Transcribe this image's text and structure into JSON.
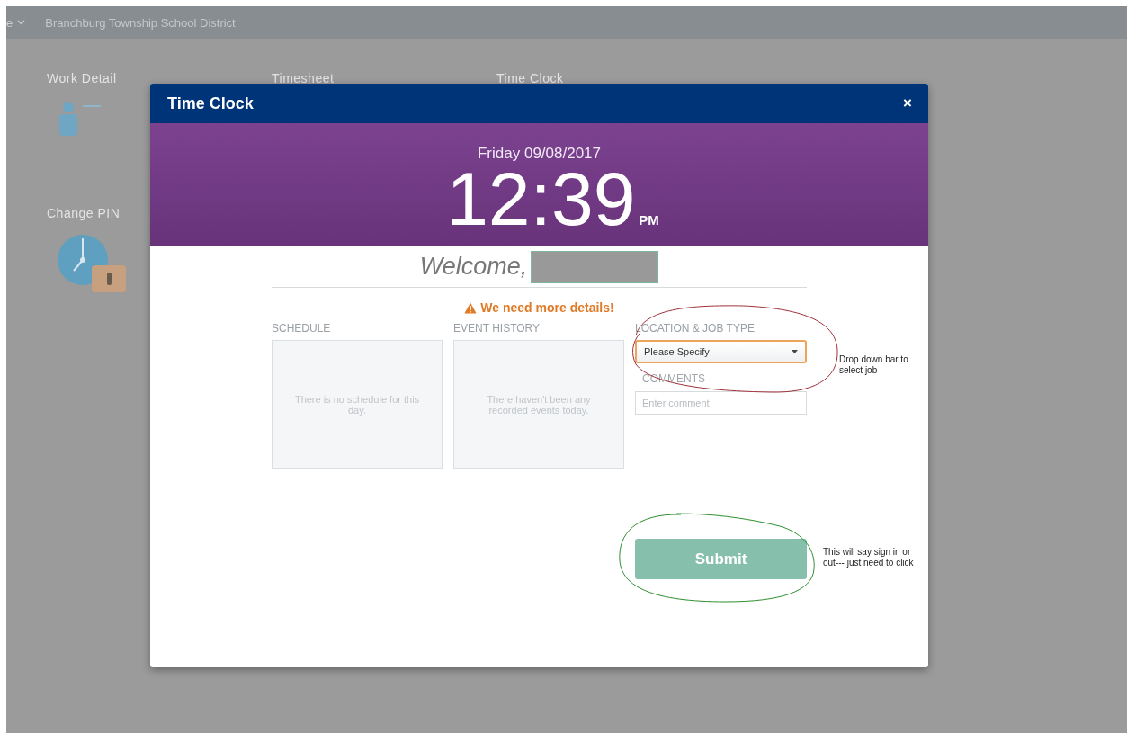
{
  "background": {
    "app_menu": "e",
    "district": "Branchburg Township School District",
    "tiles": [
      {
        "label": "Work Detail",
        "kind": "person"
      },
      {
        "label": "Timesheet",
        "kind": "none"
      },
      {
        "label": "Time Clock",
        "kind": "none"
      },
      {
        "label": "Change PIN",
        "kind": "clock-lock"
      }
    ]
  },
  "modal": {
    "title": "Time Clock",
    "close": "×",
    "date": "Friday 09/08/2017",
    "time": "12:39",
    "meridiem": "PM",
    "welcome": "Welcome,",
    "warning": "We need more details!",
    "panels": [
      {
        "heading": "SCHEDULE",
        "message": "There is no schedule for this day."
      },
      {
        "heading": "EVENT HISTORY",
        "message": "There haven't been any recorded events today."
      }
    ],
    "location": {
      "label": "LOCATION & JOB TYPE",
      "value": "Please Specify"
    },
    "comments": {
      "label": "COMMENTS",
      "placeholder": "Enter comment"
    },
    "submit": {
      "label": "Submit",
      "disabled": true
    }
  },
  "annotations": [
    {
      "text": "Drop down bar to select job",
      "color": "#a0303a"
    },
    {
      "text": "This will say sign in or out--- just need to click",
      "color": "#2f8f2f"
    }
  ]
}
